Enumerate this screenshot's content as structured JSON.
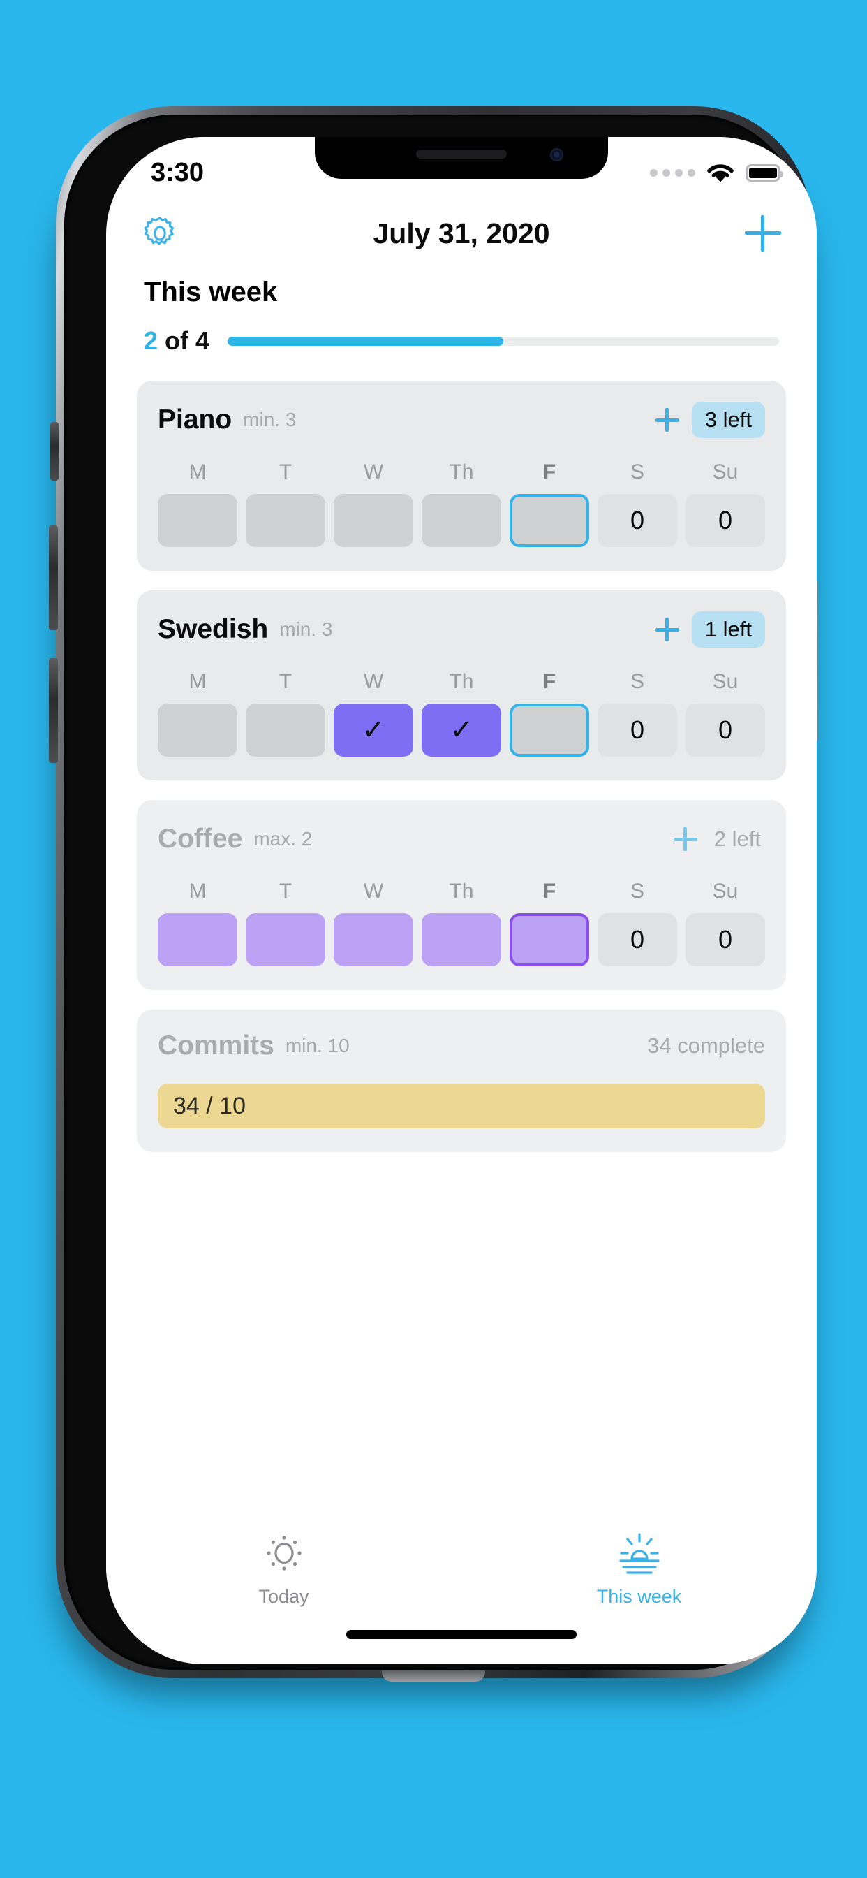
{
  "statusbar": {
    "time": "3:30",
    "signal_icon": "signal-dots-icon",
    "wifi_icon": "wifi-icon",
    "battery_icon": "battery-icon"
  },
  "navbar": {
    "settings_icon": "gear-icon",
    "title": "July 31, 2020",
    "add_icon": "plus-icon"
  },
  "section": {
    "title": "This week",
    "progress_current": "2",
    "progress_rest": " of 4",
    "progress_percent": 50,
    "accent_color": "#2bb3e8"
  },
  "day_labels": [
    "M",
    "T",
    "W",
    "Th",
    "F",
    "S",
    "Su"
  ],
  "today_index": 4,
  "cards": [
    {
      "name": "Piano",
      "subtitle": "min. 3",
      "badge": "3 left",
      "badge_style": "filled",
      "muted": false,
      "add_icon": "plus-icon",
      "cells": [
        {
          "text": "",
          "state": "empty"
        },
        {
          "text": "",
          "state": "empty"
        },
        {
          "text": "",
          "state": "empty"
        },
        {
          "text": "",
          "state": "empty"
        },
        {
          "text": "",
          "state": "empty selected-blue"
        },
        {
          "text": "0",
          "state": "future"
        },
        {
          "text": "0",
          "state": "future"
        }
      ]
    },
    {
      "name": "Swedish",
      "subtitle": "min. 3",
      "badge": "1 left",
      "badge_style": "filled",
      "muted": false,
      "add_icon": "plus-icon",
      "cells": [
        {
          "text": "",
          "state": "empty"
        },
        {
          "text": "",
          "state": "empty"
        },
        {
          "text": "✓",
          "state": "done"
        },
        {
          "text": "✓",
          "state": "done"
        },
        {
          "text": "",
          "state": "empty selected-blue"
        },
        {
          "text": "0",
          "state": "future"
        },
        {
          "text": "0",
          "state": "future"
        }
      ]
    },
    {
      "name": "Coffee",
      "subtitle": "max. 2",
      "badge": "2 left",
      "badge_style": "plain",
      "muted": true,
      "add_icon": "plus-icon",
      "cells": [
        {
          "text": "",
          "state": "filled"
        },
        {
          "text": "",
          "state": "filled"
        },
        {
          "text": "",
          "state": "filled"
        },
        {
          "text": "",
          "state": "filled"
        },
        {
          "text": "",
          "state": "filled selected-purple"
        },
        {
          "text": "0",
          "state": "future"
        },
        {
          "text": "0",
          "state": "future"
        }
      ]
    }
  ],
  "commits": {
    "name": "Commits",
    "subtitle": "min. 10",
    "status": "34 complete",
    "bar_text": "34 / 10",
    "bar_color": "#ecd893"
  },
  "tabbar": {
    "tabs": [
      {
        "label": "Today",
        "icon": "sun-icon",
        "active": false
      },
      {
        "label": "This week",
        "icon": "sunrise-icon",
        "active": true
      }
    ]
  }
}
